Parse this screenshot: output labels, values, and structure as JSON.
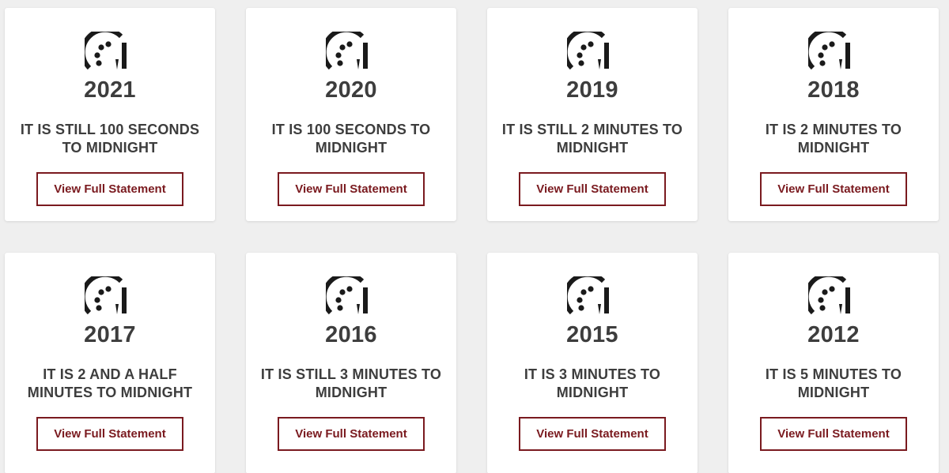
{
  "colors": {
    "page_background": "#efefef",
    "card_background": "#ffffff",
    "text": "#3d3d3d",
    "accent": "#7a1a1f"
  },
  "icon": "doomsday-clock-icon",
  "cards": [
    {
      "year": "2021",
      "statement": "IT IS STILL 100 SECONDS TO MIDNIGHT",
      "button_label": "View Full Statement"
    },
    {
      "year": "2020",
      "statement": "IT IS 100 SECONDS TO MIDNIGHT",
      "button_label": "View Full Statement"
    },
    {
      "year": "2019",
      "statement": "IT IS STILL 2 MINUTES TO MIDNIGHT",
      "button_label": "View Full Statement"
    },
    {
      "year": "2018",
      "statement": "IT IS 2 MINUTES TO MIDNIGHT",
      "button_label": "View Full Statement"
    },
    {
      "year": "2017",
      "statement": "IT IS 2 AND A HALF MINUTES TO MIDNIGHT",
      "button_label": "View Full Statement"
    },
    {
      "year": "2016",
      "statement": "IT IS STILL 3 MINUTES TO MIDNIGHT",
      "button_label": "View Full Statement"
    },
    {
      "year": "2015",
      "statement": "IT IS 3 MINUTES TO MIDNIGHT",
      "button_label": "View Full Statement"
    },
    {
      "year": "2012",
      "statement": "IT IS 5 MINUTES TO MIDNIGHT",
      "button_label": "View Full Statement"
    }
  ]
}
